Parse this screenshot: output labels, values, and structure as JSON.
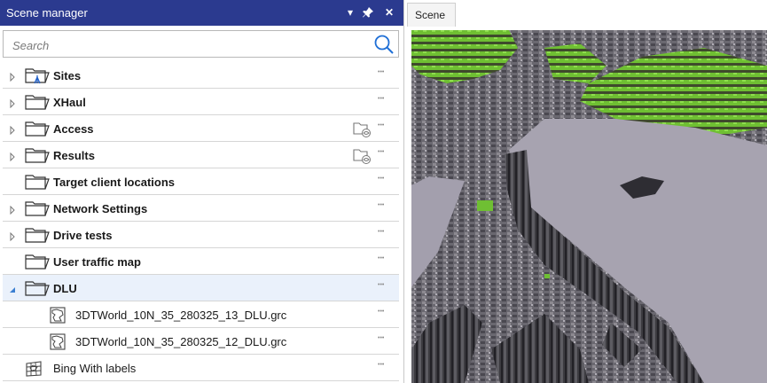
{
  "panel": {
    "title": "Scene manager",
    "buttons": {
      "dropdown": "▾",
      "pin": "pin-icon",
      "close": "✕"
    }
  },
  "search": {
    "placeholder": "Search"
  },
  "tree": {
    "items": [
      {
        "label": "Sites",
        "expandable": true,
        "icon": "sites-folder-icon",
        "more": "•••"
      },
      {
        "label": "XHaul",
        "expandable": true,
        "icon": "folder-icon",
        "more": "•••"
      },
      {
        "label": "Access",
        "expandable": true,
        "icon": "folder-icon",
        "extra": "folder-visibility-icon",
        "more": "•••"
      },
      {
        "label": "Results",
        "expandable": true,
        "icon": "folder-icon",
        "extra": "folder-visibility-icon",
        "more": "•••"
      },
      {
        "label": "Target client locations",
        "expandable": false,
        "icon": "folder-icon",
        "more": "•••"
      },
      {
        "label": "Network Settings",
        "expandable": true,
        "icon": "folder-icon",
        "more": "•••"
      },
      {
        "label": "Drive tests",
        "expandable": true,
        "icon": "folder-icon",
        "more": "•••"
      },
      {
        "label": "User traffic map",
        "expandable": false,
        "icon": "folder-icon",
        "more": "•••"
      },
      {
        "label": "DLU",
        "expandable": true,
        "expanded": true,
        "selected": true,
        "icon": "folder-icon",
        "more": "•••"
      },
      {
        "label": "3DTWorld_10N_35_280325_13_DLU.grc",
        "child": true,
        "icon": "map-file-icon",
        "more": "•••"
      },
      {
        "label": "3DTWorld_10N_35_280325_12_DLU.grc",
        "child": true,
        "icon": "map-file-icon",
        "more": "•••"
      },
      {
        "label": "Bing With labels",
        "expandable": false,
        "icon": "globe-grid-icon",
        "more": "•••"
      }
    ]
  },
  "tabs": [
    {
      "label": "Scene",
      "active": true
    }
  ],
  "colors": {
    "header": "#2b3a8f",
    "terrain_green": "#76c43a",
    "terrain_grey": "#a39fad",
    "selected_row": "#eaf1fb"
  }
}
